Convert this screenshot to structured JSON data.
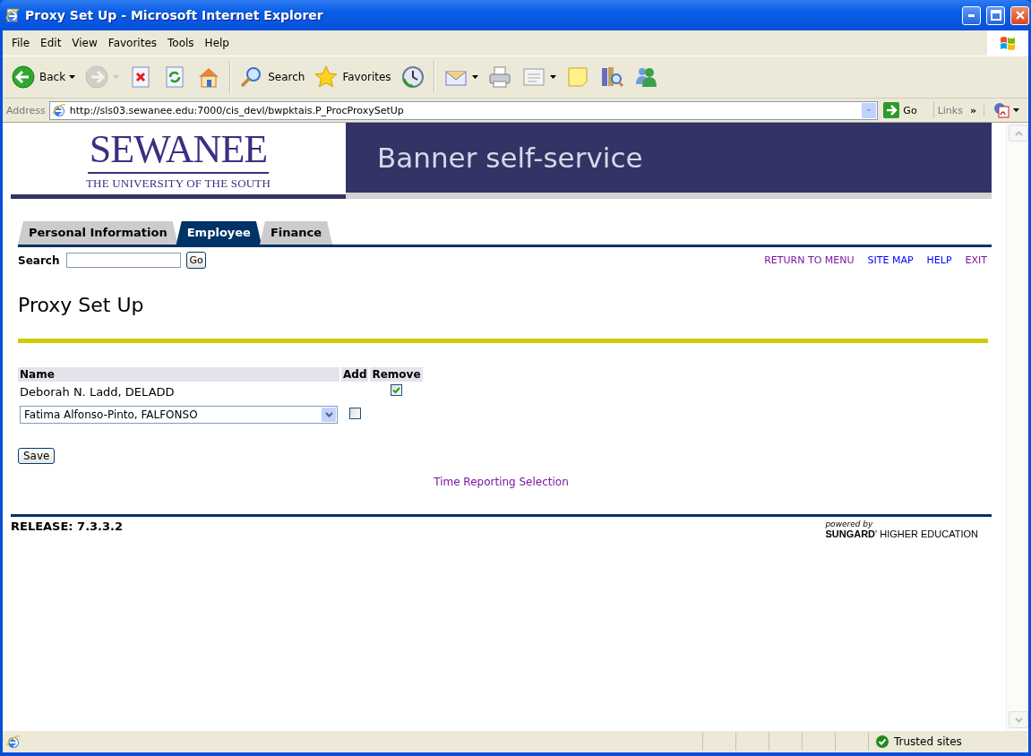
{
  "window": {
    "title": "Proxy Set Up - Microsoft Internet Explorer"
  },
  "menu": [
    "File",
    "Edit",
    "View",
    "Favorites",
    "Tools",
    "Help"
  ],
  "toolbar": [
    {
      "kind": "back",
      "label": "Back",
      "disabled": false
    },
    {
      "kind": "forward",
      "disabled": true
    },
    {
      "kind": "stop",
      "disabled": false
    },
    {
      "kind": "refresh",
      "disabled": false
    },
    {
      "kind": "home",
      "disabled": false
    },
    {
      "kind": "search",
      "label": "Search",
      "disabled": false
    },
    {
      "kind": "favorites",
      "label": "Favorites",
      "disabled": false
    },
    {
      "kind": "history",
      "disabled": false
    },
    {
      "kind": "mail",
      "disabled": false
    },
    {
      "kind": "print",
      "disabled": false
    },
    {
      "kind": "edit",
      "disabled": false
    },
    {
      "kind": "note",
      "disabled": false
    },
    {
      "kind": "research",
      "disabled": false
    },
    {
      "kind": "messenger",
      "disabled": false
    }
  ],
  "address_bar": {
    "label": "Address",
    "url": "http://sls03.sewanee.edu:7000/cis_devl/bwpktais.P_ProcProxySetUp",
    "go": "Go",
    "links": "Links",
    "chevron": "»"
  },
  "site": {
    "logo": "SEWANEE",
    "logo_subtitle": "THE UNIVERSITY OF THE SOUTH",
    "banner_title": "Banner self-service"
  },
  "tabs": [
    {
      "label": "Personal Information",
      "selected": false
    },
    {
      "label": "Employee",
      "selected": true
    },
    {
      "label": "Finance",
      "selected": false
    }
  ],
  "search": {
    "label": "Search",
    "button": "Go"
  },
  "nav_links": [
    {
      "label": "RETURN TO MENU",
      "visited": true
    },
    {
      "label": "SITE MAP",
      "visited": false
    },
    {
      "label": "HELP",
      "visited": false
    },
    {
      "label": "EXIT",
      "visited": true
    }
  ],
  "page_title": "Proxy Set Up",
  "proxy_table": {
    "columns": [
      "Name",
      "Add",
      "Remove"
    ],
    "rows": [
      {
        "kind": "existing",
        "name": "Deborah N. Ladd, DELADD",
        "checked": true
      },
      {
        "kind": "new",
        "name": "Fatima Alfonso-Pinto, FALFONSO",
        "checked": false
      }
    ]
  },
  "save_button": "Save",
  "footer_link": {
    "label": "Time Reporting Selection",
    "visited": true
  },
  "release": "RELEASE: 7.3.3.2",
  "powered_by": {
    "caption": "powered by",
    "brand": "**SUNGARD**' HIGHER EDUCATION"
  },
  "status_bar": {
    "zone": "Trusted sites"
  }
}
